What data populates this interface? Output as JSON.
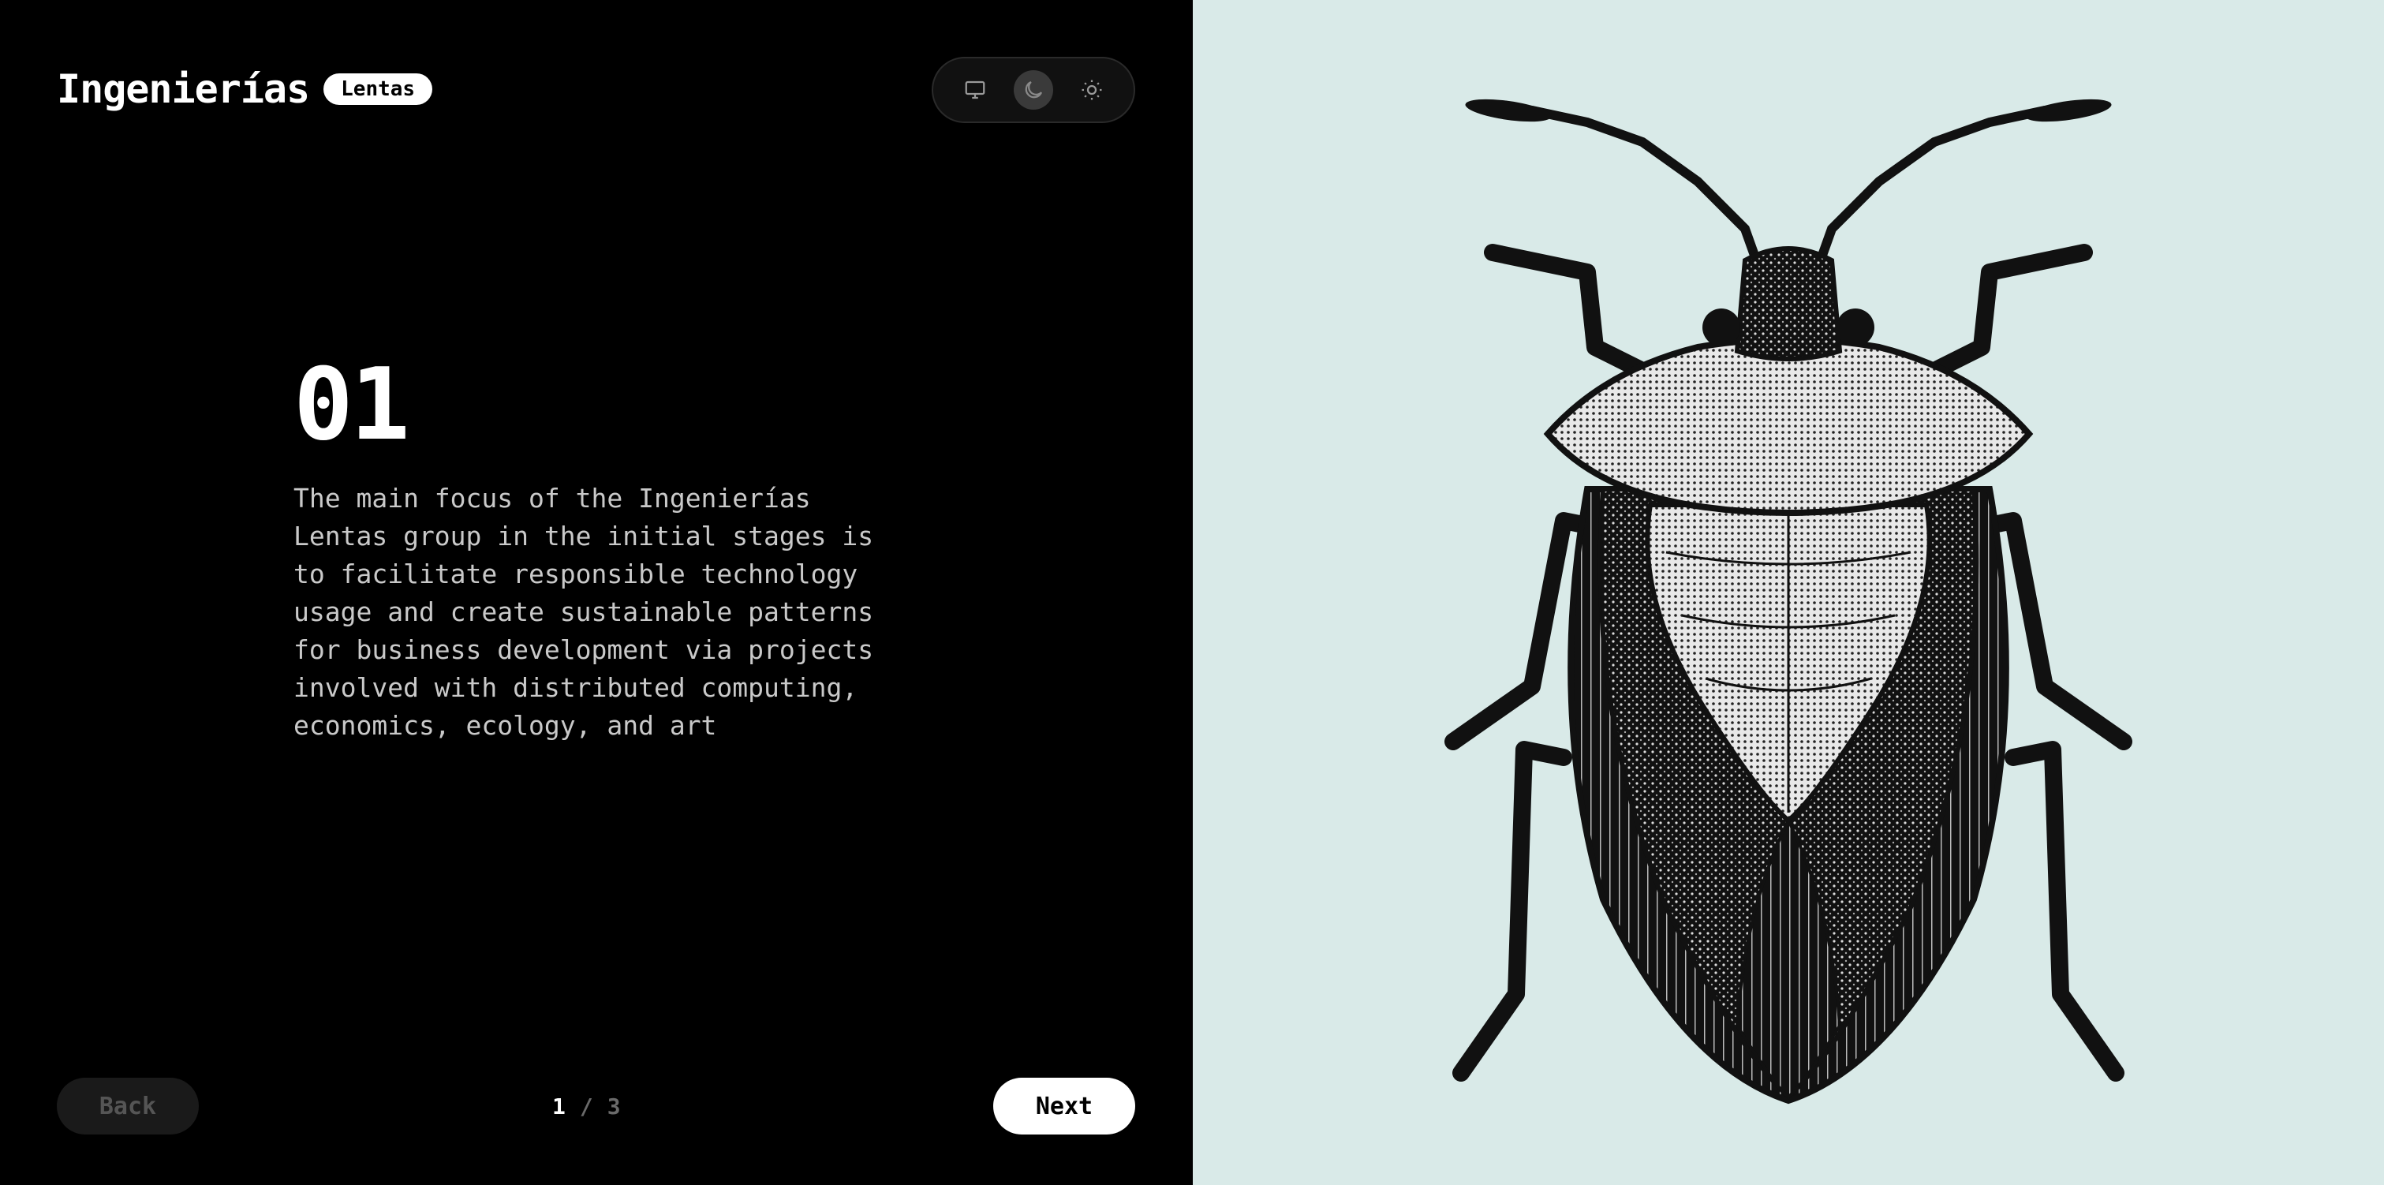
{
  "brand": {
    "title": "Ingenierías",
    "badge": "Lentas"
  },
  "theme_switch": {
    "options": [
      {
        "name": "system",
        "icon": "monitor-icon"
      },
      {
        "name": "dark",
        "icon": "moon-icon",
        "selected": true
      },
      {
        "name": "light",
        "icon": "sun-icon"
      }
    ]
  },
  "step": {
    "number": "01",
    "description": "The main focus of the Ingenierías Lentas group in the initial stages is to facilitate responsible technology usage and create sustainable patterns for business development via projects involved with distributed computing, economics, ecology, and art"
  },
  "pagination": {
    "current": "1",
    "separator": "/",
    "total": "3"
  },
  "nav": {
    "back_label": "Back",
    "next_label": "Next"
  },
  "illustration": {
    "subject": "shield-bug-illustration"
  },
  "colors": {
    "left_bg": "#000000",
    "right_bg": "#d9eae8",
    "accent": "#ffffff"
  }
}
